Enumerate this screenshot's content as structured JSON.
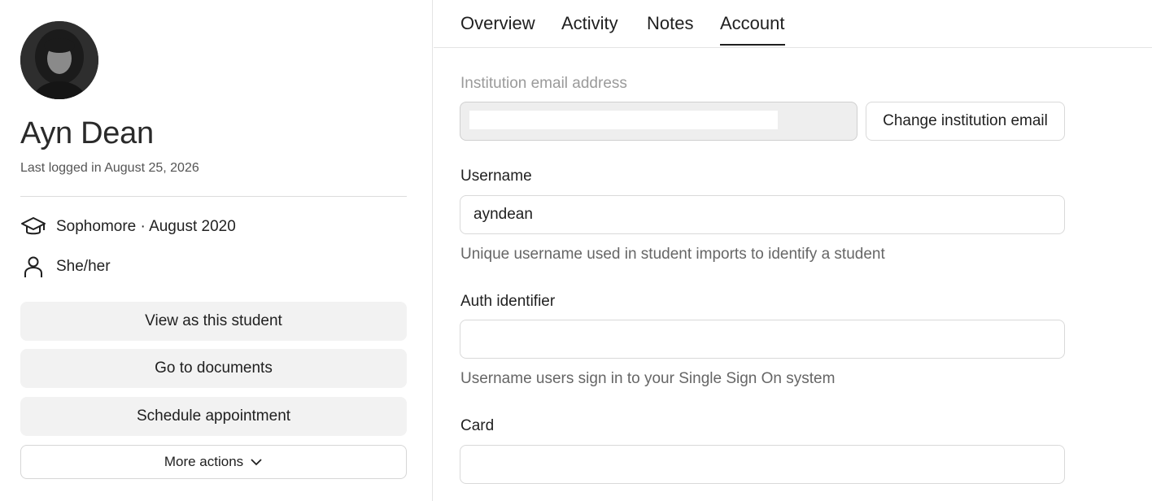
{
  "profile": {
    "name": "Ayn Dean",
    "last_login": "Last logged in August 25, 2026",
    "year_info": "Sophomore · August 2020",
    "pronouns": "She/her"
  },
  "actions": {
    "view_as": "View as this student",
    "documents": "Go to documents",
    "schedule": "Schedule appointment",
    "more": "More actions"
  },
  "tabs": [
    {
      "label": "Overview",
      "active": false
    },
    {
      "label": "Activity",
      "active": false
    },
    {
      "label": "Notes",
      "active": false
    },
    {
      "label": "Account",
      "active": true
    }
  ],
  "account": {
    "institution_email_label": "Institution email address",
    "institution_email_value": "",
    "change_email_button": "Change institution email",
    "username_label": "Username",
    "username_value": "ayndean",
    "username_help": "Unique username used in student imports to identify a student",
    "auth_label": "Auth identifier",
    "auth_value": "",
    "auth_help": "Username users sign in to your Single Sign On system",
    "card_label": "Card",
    "card_value": ""
  },
  "icons": {
    "year": "graduation-cap-icon",
    "pronouns": "person-icon",
    "more": "chevron-down-icon"
  }
}
